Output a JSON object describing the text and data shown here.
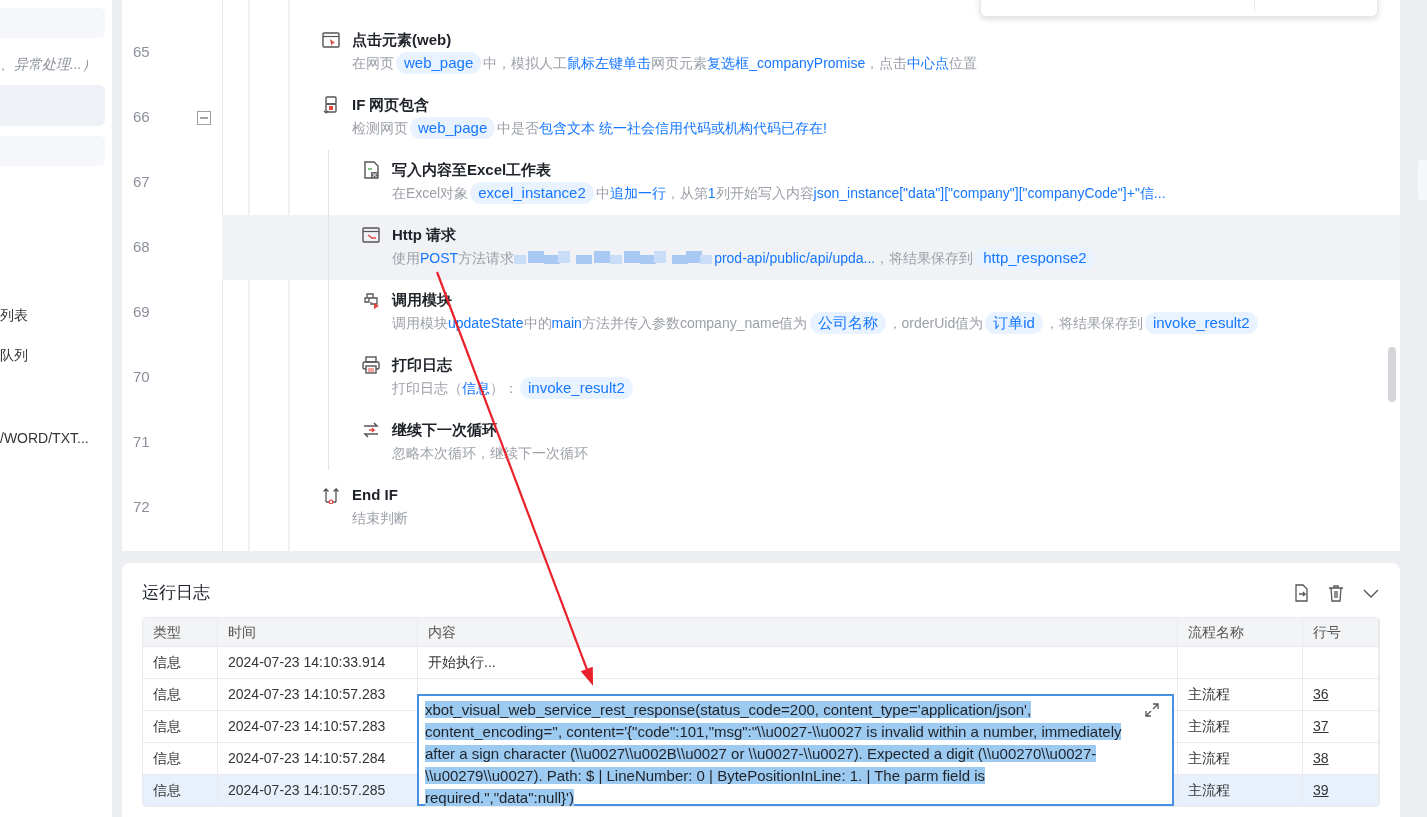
{
  "sidebar": {
    "items": [
      {
        "kind": "block"
      },
      {
        "kind": "text",
        "label": "、异常处理...）",
        "italic": true
      },
      {
        "kind": "block"
      },
      {
        "kind": "block"
      },
      {
        "kind": "text",
        "label": "列表",
        "italic": false
      },
      {
        "kind": "text",
        "label": "队列",
        "italic": false
      },
      {
        "kind": "text",
        "label": "/WORD/TXT...",
        "italic": false
      }
    ]
  },
  "steps": [
    {
      "line": "65",
      "kind": "click",
      "title": "点击元素(web)",
      "selected": false,
      "description": [
        {
          "kind": "plain",
          "text": "在网页"
        },
        {
          "kind": "var",
          "text": "web_page"
        },
        {
          "kind": "plain",
          "text": "中，模拟人工"
        },
        {
          "kind": "link",
          "text": "鼠标左键单击"
        },
        {
          "kind": "plain",
          "text": "网页元素"
        },
        {
          "kind": "link",
          "text": "复选框_companyPromise"
        },
        {
          "kind": "plain",
          "text": "，点击"
        },
        {
          "kind": "link",
          "text": "中心点"
        },
        {
          "kind": "plain",
          "text": "位置"
        }
      ]
    },
    {
      "line": "66",
      "kind": "if",
      "title": "IF 网页包含",
      "selected": false,
      "expanded": true,
      "description": [
        {
          "kind": "plain",
          "text": "检测网页"
        },
        {
          "kind": "var",
          "text": "web_page"
        },
        {
          "kind": "plain",
          "text": "中是否"
        },
        {
          "kind": "link",
          "text": "包含文本 统一社会信用代码或机构代码已存在!"
        }
      ],
      "children": [
        {
          "line": "67",
          "kind": "excel",
          "title": "写入内容至Excel工作表",
          "selected": false,
          "description": [
            {
              "kind": "plain",
              "text": "在Excel对象"
            },
            {
              "kind": "var",
              "text": "excel_instance2"
            },
            {
              "kind": "plain",
              "text": "中"
            },
            {
              "kind": "link",
              "text": "追加一行"
            },
            {
              "kind": "plain",
              "text": "，从第"
            },
            {
              "kind": "link",
              "text": "1"
            },
            {
              "kind": "plain",
              "text": "列开始写入内容"
            },
            {
              "kind": "link",
              "text": "json_instance[\"data\"][\"company\"][\"companyCode\"]+\"信..."
            }
          ]
        },
        {
          "line": "68",
          "kind": "http",
          "title": "Http 请求",
          "selected": true,
          "description": [
            {
              "kind": "plain",
              "text": "使用"
            },
            {
              "kind": "link",
              "text": "POST"
            },
            {
              "kind": "plain",
              "text": "方法请求"
            },
            {
              "kind": "blurred"
            },
            {
              "kind": "link",
              "text": "prod-api/public/api/upda..."
            },
            {
              "kind": "plain",
              "text": "，将结果保存到"
            },
            {
              "kind": "var",
              "text": "http_response2"
            }
          ]
        },
        {
          "line": "69",
          "kind": "module",
          "title": "调用模块",
          "selected": false,
          "description": [
            {
              "kind": "plain",
              "text": "调用模块"
            },
            {
              "kind": "link",
              "text": "updateState"
            },
            {
              "kind": "plain",
              "text": "中的"
            },
            {
              "kind": "link",
              "text": "main"
            },
            {
              "kind": "plain",
              "text": "方法并传入参数company_name值为"
            },
            {
              "kind": "var",
              "text": "公司名称"
            },
            {
              "kind": "plain",
              "text": "，orderUid值为"
            },
            {
              "kind": "var",
              "text": "订单id"
            },
            {
              "kind": "plain",
              "text": "，将结果保存到"
            },
            {
              "kind": "var",
              "text": "invoke_result2"
            }
          ]
        },
        {
          "line": "70",
          "kind": "print",
          "title": "打印日志",
          "selected": false,
          "description": [
            {
              "kind": "plain",
              "text": "打印日志（"
            },
            {
              "kind": "link",
              "text": "信息"
            },
            {
              "kind": "plain",
              "text": "）："
            },
            {
              "kind": "var",
              "text": "invoke_result2"
            }
          ]
        },
        {
          "line": "71",
          "kind": "loop",
          "title": "继续下一次循环",
          "selected": false,
          "description": [
            {
              "kind": "plain",
              "text": "忽略本次循环，继续下一次循环"
            }
          ]
        }
      ]
    },
    {
      "line": "72",
      "kind": "endif",
      "title": "End IF",
      "selected": false,
      "description": [
        {
          "kind": "plain",
          "text": "结束判断"
        }
      ]
    }
  ],
  "log": {
    "title": "运行日志",
    "columns": [
      "类型",
      "时间",
      "内容",
      "流程名称",
      "行号"
    ],
    "rows": [
      {
        "type": "信息",
        "time": "2024-07-23 14:10:33.914",
        "content": "开始执行...",
        "selected": false
      },
      {
        "type": "信息",
        "time": "2024-07-23 14:10:57.283",
        "flow": "主流程",
        "line": "36",
        "selected": false
      },
      {
        "type": "信息",
        "time": "2024-07-23 14:10:57.283",
        "flow": "主流程",
        "line": "37",
        "selected": false
      },
      {
        "type": "信息",
        "time": "2024-07-23 14:10:57.284",
        "flow": "主流程",
        "line": "38",
        "selected": false
      },
      {
        "type": "信息",
        "time": "2024-07-23 14:10:57.285",
        "flow": "主流程",
        "line": "39",
        "selected": true
      }
    ],
    "cell_popup": {
      "text": "xbot_visual_web_service_rest_response(status_code=200, content_type='application/json', content_encoding='', content='{\"code\":101,\"msg\":\"\\\\u0027-\\\\u0027 is invalid within a number, immediately after a sign character (\\\\u0027\\\\u002B\\\\u0027 or \\\\u0027-\\\\u0027). Expected a digit (\\\\u00270\\\\u0027-\\\\u00279\\\\u0027). Path: $ | LineNumber: 0 | BytePositionInLine: 1. | The parm field is required.\",\"data\":null}')",
      "text_selected": true
    }
  }
}
